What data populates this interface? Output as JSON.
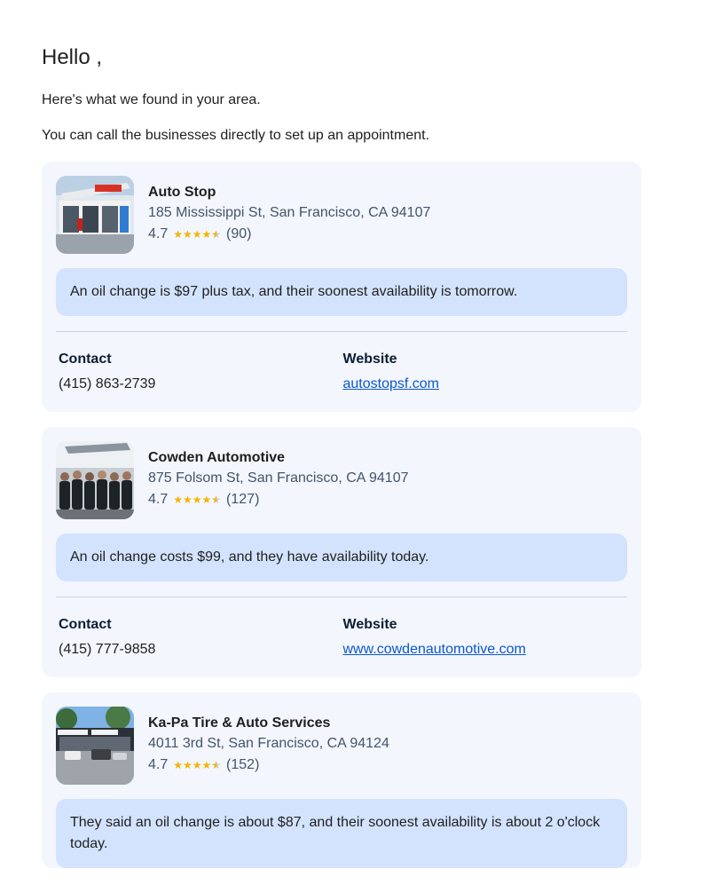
{
  "greeting": "Hello ,",
  "intro_line_1": "Here's what we found in your area.",
  "intro_line_2": "You can call the businesses directly to set up an appointment.",
  "labels": {
    "contact": "Contact",
    "website": "Website"
  },
  "businesses": [
    {
      "name": "Auto Stop",
      "address": "185 Mississippi St, San Francisco, CA 94107",
      "rating": "4.7",
      "reviews": "(90)",
      "summary": "An oil change is $97 plus tax, and their soonest availability is tomorrow.",
      "phone": "(415) 863-2739",
      "website": "autostopsf.com"
    },
    {
      "name": "Cowden Automotive",
      "address": "875 Folsom St, San Francisco, CA 94107",
      "rating": "4.7",
      "reviews": "(127)",
      "summary": "An oil change costs $99, and they have availability today.",
      "phone": "(415) 777-9858",
      "website": "www.cowdenautomotive.com"
    },
    {
      "name": "Ka-Pa Tire & Auto Services",
      "address": "4011 3rd St, San Francisco, CA 94124",
      "rating": "4.7",
      "reviews": "(152)",
      "summary": "They said an oil change is about $87, and their soonest availability is about 2 o'clock today."
    }
  ],
  "colors": {
    "card_bg": "#f3f6fc",
    "summary_bg": "#d3e3fd",
    "link": "#0b57d0",
    "star": "#f4b400"
  }
}
